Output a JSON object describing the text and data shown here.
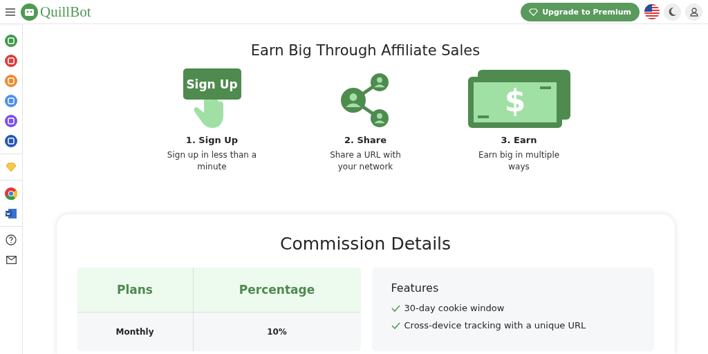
{
  "header": {
    "logo_text": "QuillBot",
    "upgrade_button": "Upgrade to Premium"
  },
  "hero": {
    "title": "Earn Big Through Affiliate Sales",
    "steps": [
      {
        "kind": "signup",
        "icon_label": "Sign Up",
        "title": "1. Sign Up",
        "description": "Sign up in less than a minute"
      },
      {
        "kind": "share",
        "title": "2. Share",
        "description": "Share a URL with your network"
      },
      {
        "kind": "earn",
        "icon_label": "$",
        "title": "3. Earn",
        "description": "Earn big in multiple ways"
      }
    ]
  },
  "commission": {
    "title": "Commission Details",
    "table": {
      "columns": [
        "Plans",
        "Percentage"
      ],
      "rows": [
        [
          "Monthly",
          "10%"
        ]
      ]
    },
    "features": {
      "title": "Features",
      "items": [
        "30-day cookie window",
        "Cross-device tracking with a unique URL"
      ]
    }
  }
}
